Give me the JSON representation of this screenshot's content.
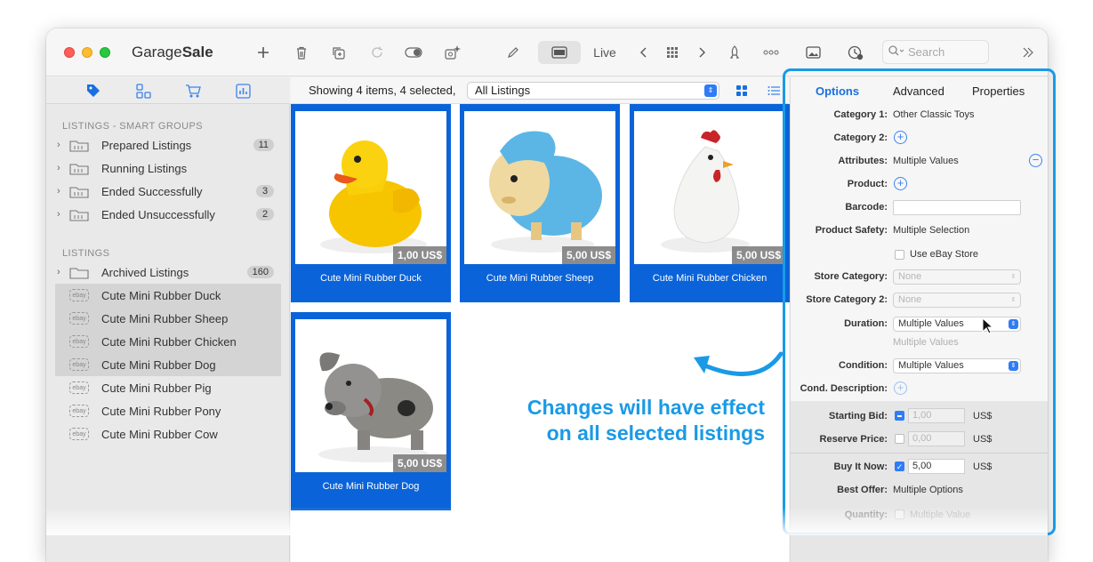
{
  "app": {
    "name_light": "Garage",
    "name_bold": "Sale"
  },
  "toolbar": {
    "live_label": "Live",
    "search_placeholder": "Search",
    "icons": [
      "plus-icon",
      "trash-icon",
      "duplicate-icon",
      "refresh-icon",
      "toggle-icon",
      "ai-magic-icon",
      "pencil-icon",
      "window-icon",
      "chevron-left-icon",
      "grid-apps-icon",
      "chevron-right-icon",
      "rocket-icon",
      "more-icon",
      "image-icon",
      "clock-alert-icon",
      "magnifier-icon",
      "expand-icon"
    ]
  },
  "sidebar": {
    "smart_header": "LISTINGS - SMART GROUPS",
    "smart_groups": [
      {
        "label": "Prepared Listings",
        "count": "11"
      },
      {
        "label": "Running Listings",
        "count": ""
      },
      {
        "label": "Ended Successfully",
        "count": "3"
      },
      {
        "label": "Ended Unsuccessfully",
        "count": "2"
      }
    ],
    "listings_header": "LISTINGS",
    "archived": {
      "label": "Archived Listings",
      "count": "160"
    },
    "ebay_badge": "ebay",
    "items": [
      {
        "label": "Cute Mini Rubber Duck",
        "selected": true
      },
      {
        "label": "Cute Mini Rubber Sheep",
        "selected": true
      },
      {
        "label": "Cute Mini Rubber Chicken",
        "selected": true
      },
      {
        "label": "Cute Mini Rubber Dog",
        "selected": true
      },
      {
        "label": "Cute Mini Rubber Pig",
        "selected": false
      },
      {
        "label": "Cute Mini Rubber Pony",
        "selected": false
      },
      {
        "label": "Cute Mini Rubber Cow",
        "selected": false
      }
    ]
  },
  "main": {
    "showing": "Showing 4 items, 4 selected,",
    "list_filter": "All Listings",
    "cards": [
      {
        "title": "Cute Mini Rubber Duck",
        "price": "1,00 US$"
      },
      {
        "title": "Cute Mini Rubber Sheep",
        "price": "5,00 US$"
      },
      {
        "title": "Cute Mini Rubber Chicken",
        "price": "5,00 US$"
      },
      {
        "title": "Cute Mini Rubber Dog",
        "price": "5,00 US$"
      }
    ]
  },
  "inspector": {
    "tabs": {
      "options": "Options",
      "advanced": "Advanced",
      "properties": "Properties"
    },
    "category1_label": "Category 1:",
    "category1_value": "Other Classic Toys",
    "category2_label": "Category 2:",
    "attributes_label": "Attributes:",
    "attributes_value": "Multiple Values",
    "product_label": "Product:",
    "barcode_label": "Barcode:",
    "safety_label": "Product Safety:",
    "safety_value": "Multiple Selection",
    "use_store_label": "Use eBay Store",
    "store_cat_label": "Store Category:",
    "store_cat_value": "None",
    "store_cat2_label": "Store Category 2:",
    "store_cat2_value": "None",
    "duration_label": "Duration:",
    "duration_value": "Multiple Values",
    "duration_hint": "Multiple Values",
    "condition_label": "Condition:",
    "condition_value": "Multiple Values",
    "cond_desc_label": "Cond. Description:",
    "starting_bid_label": "Starting Bid:",
    "starting_bid_value": "1,00",
    "currency": "US$",
    "reserve_label": "Reserve Price:",
    "reserve_value": "0,00",
    "buy_now_label": "Buy It Now:",
    "buy_now_value": "5,00",
    "best_offer_label": "Best Offer:",
    "best_offer_value": "Multiple Options",
    "quantity_label": "Quantity:",
    "quantity_value": "Multiple Value"
  },
  "callout": {
    "line1": "Changes will have effect",
    "line2": "on all selected listings"
  },
  "colors": {
    "accent": "#1a6fe0",
    "selection_blue": "#0a63d8",
    "callout": "#1a9ae6"
  }
}
